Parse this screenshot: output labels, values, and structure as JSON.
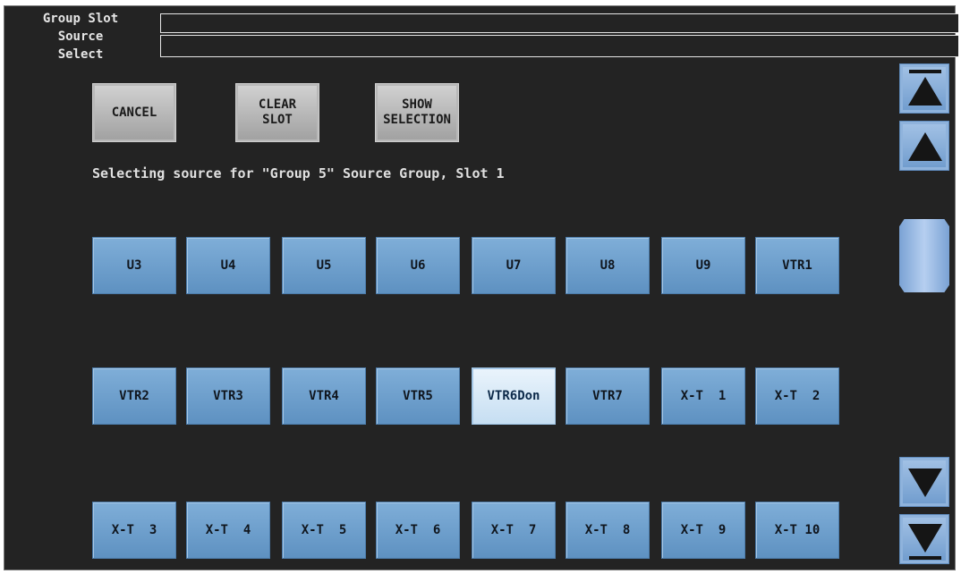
{
  "header": {
    "label_group_slot": "Group Slot",
    "label_source": "Source",
    "label_select": "Select"
  },
  "actions": {
    "cancel": "CANCEL",
    "clear_slot": "CLEAR\nSLOT",
    "show_selection": "SHOW\nSELECTION"
  },
  "status_text": "Selecting source for \"Group 5\" Source Group, Slot 1",
  "sources": {
    "row1": [
      "U3",
      "U4",
      "U5",
      "U6",
      "U7",
      "U8",
      "U9",
      "VTR1"
    ],
    "row2": [
      "VTR2",
      "VTR3",
      "VTR4",
      "VTR5",
      "VTR6Don",
      "VTR7",
      "X-T  1",
      "X-T  2"
    ],
    "row3": [
      "X-T  3",
      "X-T  4",
      "X-T  5",
      "X-T  6",
      "X-T  7",
      "X-T  8",
      "X-T  9",
      "X-T 10"
    ]
  },
  "selected_source": "VTR6Don",
  "scrollbar": {
    "icons": [
      "scroll-top-icon",
      "scroll-up-icon",
      "scroll-down-icon",
      "scroll-bottom-icon"
    ]
  },
  "colors": {
    "background": "#232323",
    "source_button": "#6f9fcf",
    "selected_source_button": "#d8eaf8",
    "gray_button": "#b8b8b8"
  }
}
